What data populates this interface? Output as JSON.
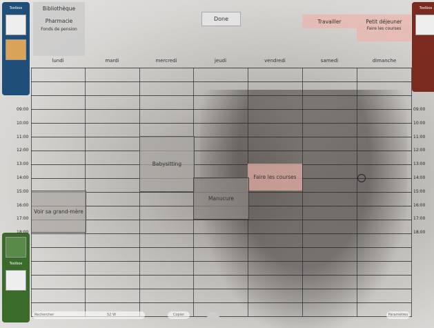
{
  "top": {
    "left_tags": [
      "Bibliothèque",
      "Pharmacie",
      "Fonds de pension"
    ],
    "done_label": "Done",
    "right_tags": [
      "Travailler",
      "Petit déjeuner",
      "Faire les courses"
    ]
  },
  "days": [
    "lundi",
    "mardi",
    "mercredi",
    "jeudi",
    "vendredi",
    "samedi",
    "dimanche"
  ],
  "times_left": [
    "09:00",
    "10:00",
    "11:00",
    "12:00",
    "13:00",
    "14:00",
    "15:00",
    "16:00",
    "17:00",
    "18:00"
  ],
  "times_right": [
    "09:00",
    "10:00",
    "11:00",
    "12:00",
    "13:00",
    "14:00",
    "15:00",
    "16:00",
    "17:00",
    "18:00"
  ],
  "events": {
    "babysitting": "Babysitting",
    "faire_courses": "Faire les courses",
    "manucure": "Manucure",
    "voir_grand_mere": "Voir sa grand-mère"
  },
  "toolbox": {
    "label": "Toolbox"
  },
  "bottom": {
    "search_placeholder": "Rechercher",
    "week_label": "S2 W",
    "copy_label": "Copier",
    "params_label": "Paramètres"
  },
  "colors": {
    "blue_toolbox": "#1f4f78",
    "red_toolbox": "#7a2a1e",
    "green_toolbox": "#3a6b2a",
    "accent_red": "#e7b8b2"
  }
}
